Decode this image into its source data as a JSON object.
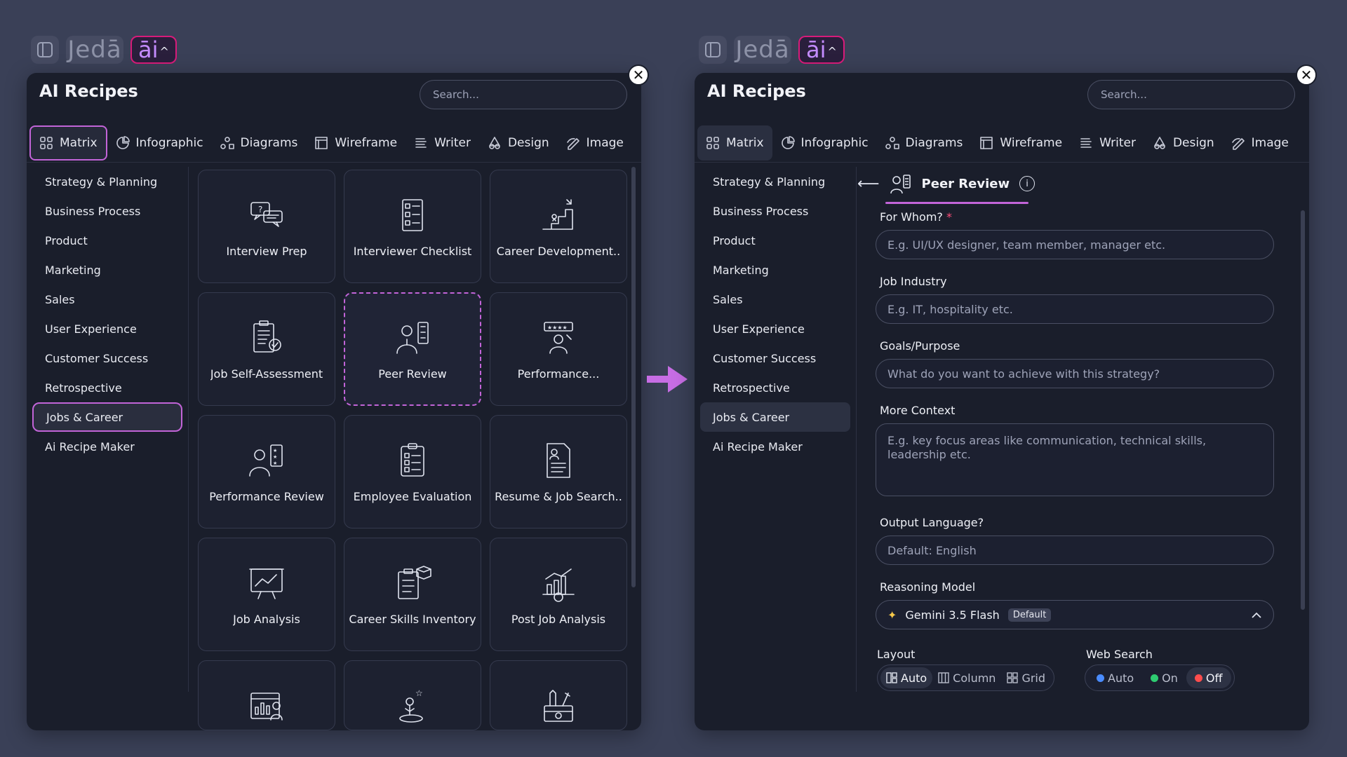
{
  "topbar": {
    "jeda_label": "Jedā",
    "ai_label": "āi",
    "caret": "^"
  },
  "left_panel": {
    "title": "AI Recipes",
    "search_placeholder": "Search...",
    "tabs": [
      {
        "label": "Matrix",
        "icon": "grid-icon"
      },
      {
        "label": "Infographic",
        "icon": "pie-icon"
      },
      {
        "label": "Diagrams",
        "icon": "diagram-icon"
      },
      {
        "label": "Wireframe",
        "icon": "wireframe-icon"
      },
      {
        "label": "Writer",
        "icon": "writer-icon"
      },
      {
        "label": "Design",
        "icon": "design-icon"
      },
      {
        "label": "Image",
        "icon": "image-icon"
      }
    ],
    "categories": [
      "Strategy & Planning",
      "Business Process",
      "Product",
      "Marketing",
      "Sales",
      "User Experience",
      "Customer Success",
      "Retrospective",
      "Jobs & Career",
      "Ai Recipe Maker"
    ],
    "cards": [
      {
        "label": "Interview Prep",
        "icon": "interview-icon"
      },
      {
        "label": "Interviewer Checklist",
        "icon": "checklist-icon"
      },
      {
        "label": "Career Development..",
        "icon": "career-growth-icon"
      },
      {
        "label": "Job Self-Assessment",
        "icon": "self-assessment-icon"
      },
      {
        "label": "Peer Review",
        "icon": "peer-review-icon"
      },
      {
        "label": "Performance...",
        "icon": "performance-icon"
      },
      {
        "label": "Performance Review",
        "icon": "performance-review-icon"
      },
      {
        "label": "Employee Evaluation",
        "icon": "evaluation-icon"
      },
      {
        "label": "Resume & Job Search..",
        "icon": "resume-icon"
      },
      {
        "label": "Job Analysis",
        "icon": "analysis-board-icon"
      },
      {
        "label": "Career Skills Inventory",
        "icon": "skills-inventory-icon"
      },
      {
        "label": "Post Job Analysis",
        "icon": "post-analysis-icon"
      },
      {
        "label": "",
        "icon": "report-people-icon"
      },
      {
        "label": "",
        "icon": "goal-person-icon"
      },
      {
        "label": "",
        "icon": "tools-box-icon"
      }
    ]
  },
  "right_panel": {
    "title": "AI Recipes",
    "search_placeholder": "Search...",
    "recipe_title": "Peer Review",
    "back_arrow": "⟵",
    "info_mark": "i",
    "form": {
      "for_whom_label": "For Whom?",
      "required_mark": "*",
      "for_whom_placeholder": "E.g. UI/UX designer, team member, manager etc.",
      "industry_label": "Job Industry",
      "industry_placeholder": "E.g. IT, hospitality etc.",
      "goals_label": "Goals/Purpose",
      "goals_placeholder": "What do you want to achieve with this strategy?",
      "context_label": "More Context",
      "context_placeholder": "E.g. key focus areas like communication, technical skills, leadership etc.",
      "language_label": "Output Language?",
      "language_placeholder": "Default: English",
      "model_label": "Reasoning Model",
      "model_value": "Gemini 3.5 Flash",
      "model_badge": "Default",
      "layout_label": "Layout",
      "layout_options": [
        "Auto",
        "Column",
        "Grid"
      ],
      "web_search_label": "Web Search",
      "web_search_options": [
        {
          "label": "Auto",
          "color": "#4a8cff"
        },
        {
          "label": "On",
          "color": "#2ecc71"
        },
        {
          "label": "Off",
          "color": "#ff4d4d"
        }
      ]
    }
  },
  "colors": {
    "accent": "#c264d8",
    "brand_pink": "#d81b7a",
    "background": "#3a4057",
    "panel": "#1a1e2b"
  }
}
